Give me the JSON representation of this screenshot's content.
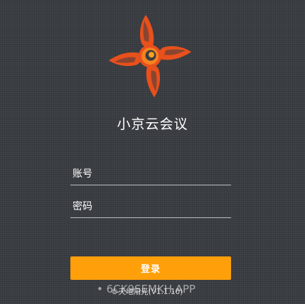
{
  "app": {
    "title": "小京云会议"
  },
  "form": {
    "account_placeholder": "账号",
    "password_placeholder": "密码",
    "login_label": "登录"
  },
  "footer": {
    "version": "©天地阳光(V1.1.10)",
    "watermark": "• 6CK9SEMKH.APP"
  },
  "icons": {
    "logo": "pinwheel-swirl-logo-icon"
  },
  "colors": {
    "accent": "#ff9f0a",
    "logo_orange": "#f58220",
    "logo_gold": "#f9a11b",
    "logo_red": "#e8501c",
    "background": "#3a3d42",
    "text": "#ffffff",
    "divider": "#b9bcc1"
  }
}
